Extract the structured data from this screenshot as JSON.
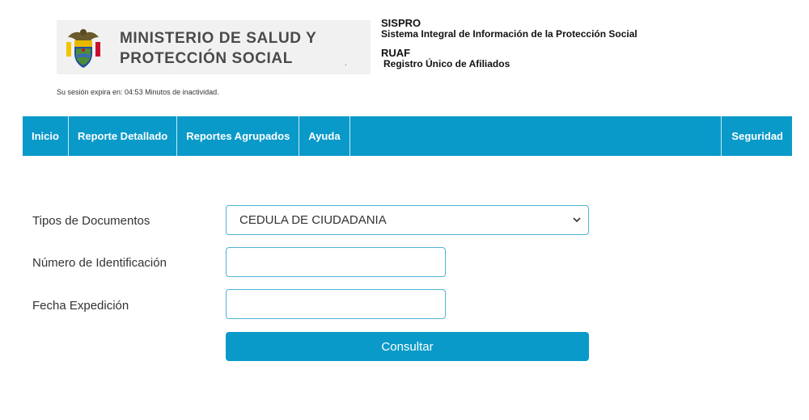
{
  "header": {
    "ministry_line1": "MINISTERIO DE SALUD Y",
    "ministry_line2": "PROTECCIÓN SOCIAL",
    "tiny_mark": ".",
    "system1_title": "SISPRO",
    "system1_desc": "Sistema Integral de Información de la Protección Social",
    "system2_title": "RUAF",
    "system2_desc": "Registro Único de Afiliados",
    "crest_icon": "colombia-coat-of-arms"
  },
  "session": {
    "text": "Su sesión expira en: 04:53 Minutos de inactividad."
  },
  "nav": {
    "items": [
      {
        "label": "Inicio"
      },
      {
        "label": "Reporte Detallado"
      },
      {
        "label": "Reportes Agrupados"
      },
      {
        "label": "Ayuda"
      }
    ],
    "right_label": "Seguridad",
    "bg_color": "#0a9ac9"
  },
  "form": {
    "doc_type_label": "Tipos de Documentos",
    "doc_type_value": "CEDULA DE CIUDADANIA",
    "id_number_label": "Número de Identificación",
    "id_number_value": "",
    "expedition_date_label": "Fecha Expedición",
    "expedition_date_value": "",
    "submit_label": "Consultar"
  }
}
